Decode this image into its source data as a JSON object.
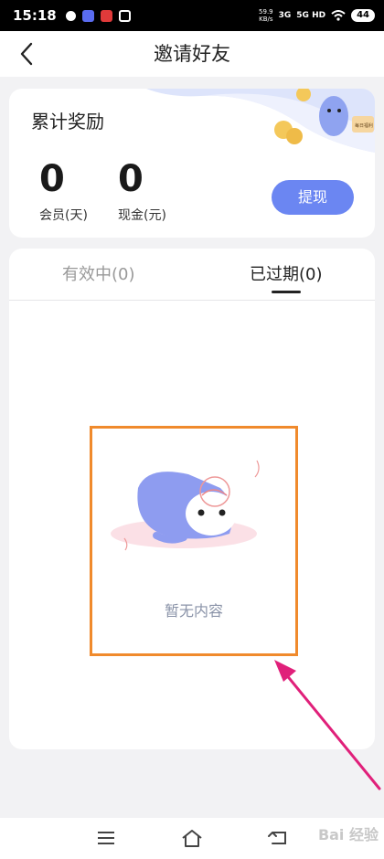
{
  "status_bar": {
    "time": "15:18",
    "net_speed_value": "59.9",
    "net_speed_unit": "KB/s",
    "signal_1": "3G",
    "signal_2": "5G HD",
    "battery": "44"
  },
  "header": {
    "title": "邀请好友"
  },
  "reward": {
    "title": "累计奖励",
    "membership_value": "0",
    "membership_label": "会员(天)",
    "cash_value": "0",
    "cash_label": "现金(元)",
    "withdraw_label": "提现",
    "deco_badge_text": "每日福利"
  },
  "tabs": [
    {
      "label": "有效中(0)",
      "active": false
    },
    {
      "label": "已过期(0)",
      "active": true
    }
  ],
  "empty_state": {
    "message": "暂无内容"
  },
  "watermark": "Bai 经验",
  "colors": {
    "accent": "#6b86f2",
    "highlight_box": "#f08a2c",
    "arrow": "#e0207a"
  }
}
